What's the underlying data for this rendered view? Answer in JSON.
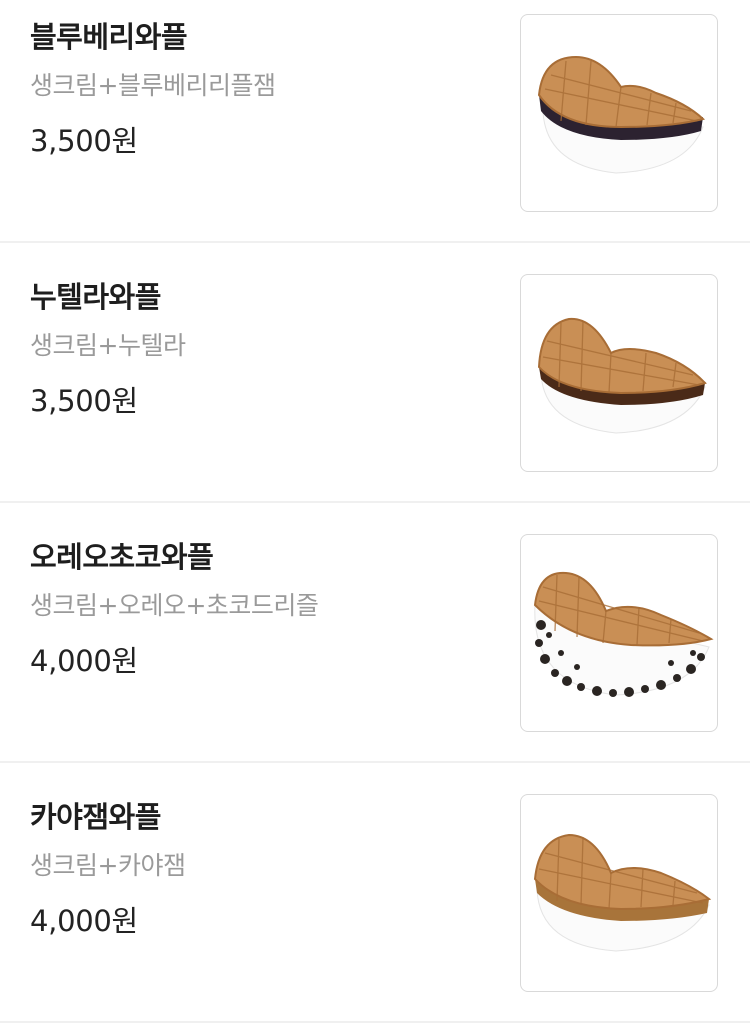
{
  "menu": {
    "items": [
      {
        "name": "블루베리와플",
        "description": "생크림+블루베리리플잼",
        "price": "3,500원",
        "filling": "blueberry"
      },
      {
        "name": "누텔라와플",
        "description": "생크림+누텔라",
        "price": "3,500원",
        "filling": "nutella"
      },
      {
        "name": "오레오초코와플",
        "description": "생크림+오레오+초코드리즐",
        "price": "4,000원",
        "filling": "oreo"
      },
      {
        "name": "카야잼와플",
        "description": "생크림+카야잼",
        "price": "4,000원",
        "filling": "kaya"
      }
    ]
  },
  "colors": {
    "waffle": "#c98f55",
    "waffle_grid": "#a86d36",
    "cream": "#fbfbfb",
    "blueberry": "#2c2230",
    "nutella": "#4a2a18",
    "oreo_crumb": "#2a2522",
    "kaya": "#a8743a"
  }
}
